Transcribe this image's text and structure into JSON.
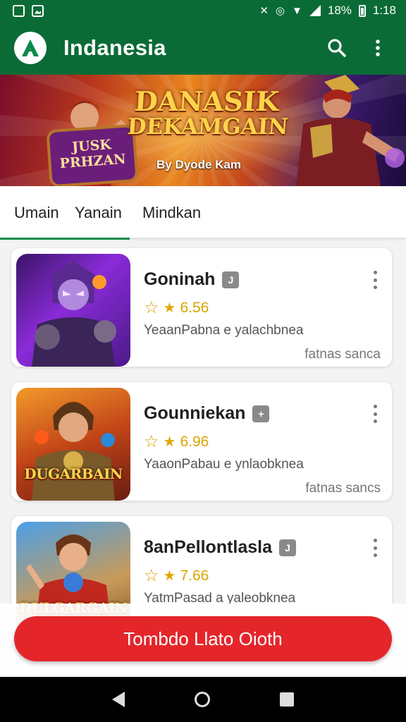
{
  "status_bar": {
    "battery": "18%",
    "time": "1:18"
  },
  "app_bar": {
    "title": "Indanesia",
    "icons": [
      "app-logo-icon",
      "search-icon",
      "more-vert-icon"
    ]
  },
  "banner": {
    "title_line1": "DANASIK",
    "title_line2": "DEKAMGAIN",
    "subtitle": "By Dyode Kam",
    "scroll_line1": "JUSK",
    "scroll_line2": "PRHZAN"
  },
  "tabs": [
    {
      "label": "Umain",
      "selected": true
    },
    {
      "label": "Yanain",
      "selected": false
    },
    {
      "label": "Mindkan",
      "selected": false
    }
  ],
  "games": [
    {
      "title": "Goninah",
      "badge": "J",
      "rating": "6.56",
      "description": "YeaanPabna e yalachbnea",
      "meta": "fatnas sanca",
      "thumb_text": ""
    },
    {
      "title": "Gounniekan",
      "badge": "+",
      "rating": "6.96",
      "description": "YaaonPabau e ynlaobknea",
      "meta": "fatnas sancs",
      "thumb_text": "DUGARBAIN"
    },
    {
      "title": "8anPellontlasla",
      "badge": "J",
      "rating": "7.66",
      "description": "YatmPasad a yaleobknea",
      "meta": "",
      "thumb_text": "DULGARGAIN"
    }
  ],
  "cta": {
    "label": "Tombdo Llato Oioth"
  },
  "colors": {
    "app_bar": "#0b6b37",
    "accent": "#0b8a4a",
    "cta": "#e4262b",
    "star": "#e0a800"
  }
}
